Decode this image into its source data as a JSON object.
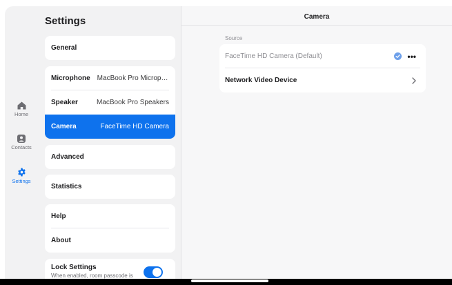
{
  "rail": {
    "items": [
      {
        "label": "Home",
        "icon": "home-icon"
      },
      {
        "label": "Contacts",
        "icon": "contacts-icon"
      },
      {
        "label": "Settings",
        "icon": "gear-icon",
        "active": true
      }
    ]
  },
  "settings": {
    "title": "Settings",
    "general": "General",
    "microphone": {
      "label": "Microphone",
      "value": "MacBook Pro Micropho..."
    },
    "speaker": {
      "label": "Speaker",
      "value": "MacBook Pro Speakers"
    },
    "camera": {
      "label": "Camera",
      "value": "FaceTime HD Camera"
    },
    "advanced": "Advanced",
    "statistics": "Statistics",
    "help": "Help",
    "about": "About",
    "lock": {
      "title": "Lock Settings",
      "subtitle": "When enabled, room passcode is",
      "enabled": true
    }
  },
  "detail": {
    "title": "Camera",
    "section_label": "Source",
    "sources": [
      {
        "label": "FaceTime HD Camera (Default)",
        "selected": true
      },
      {
        "label": "Network Video Device"
      }
    ]
  },
  "colors": {
    "accent": "#0e72ed",
    "check": "#6ea0ea",
    "background": "#f2f2f3"
  }
}
